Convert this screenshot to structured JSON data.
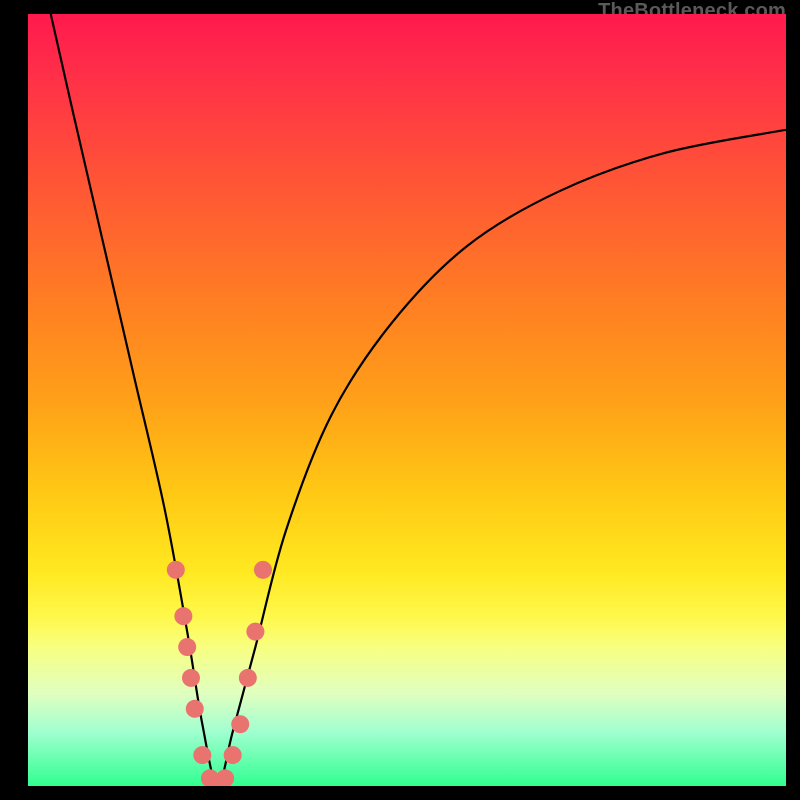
{
  "watermark": "TheBottleneck.com",
  "chart_data": {
    "type": "line",
    "title": "",
    "xlabel": "",
    "ylabel": "",
    "xlim": [
      0,
      100
    ],
    "ylim": [
      0,
      100
    ],
    "optimal_x": 25,
    "series": [
      {
        "name": "bottleneck-curve",
        "x": [
          3,
          6,
          10,
          14,
          18,
          21,
          23,
          25,
          27,
          30,
          34,
          40,
          48,
          58,
          70,
          84,
          100
        ],
        "y": [
          100,
          87,
          70,
          53,
          36,
          20,
          8,
          0,
          7,
          18,
          33,
          48,
          60,
          70,
          77,
          82,
          85
        ]
      }
    ],
    "markers": {
      "name": "highlighted-points",
      "color": "#e9736f",
      "x": [
        19.5,
        20.5,
        21,
        21.5,
        22,
        23,
        24,
        25,
        26,
        27,
        28,
        29,
        30,
        31
      ],
      "y": [
        28,
        22,
        18,
        14,
        10,
        4,
        1,
        0,
        1,
        4,
        8,
        14,
        20,
        28
      ]
    }
  }
}
